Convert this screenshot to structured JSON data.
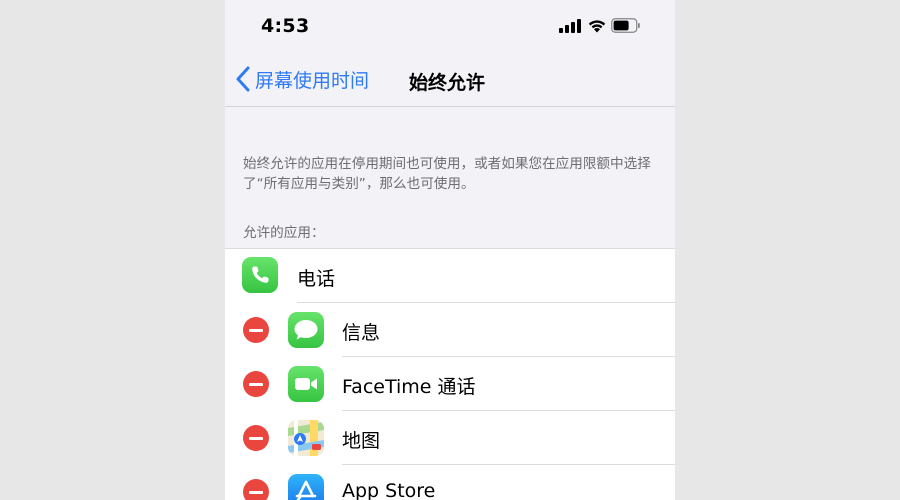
{
  "status_bar": {
    "time": "4:53",
    "icons": [
      "signal-icon",
      "wifi-icon",
      "battery-icon"
    ]
  },
  "nav": {
    "back_label": "屏幕使用时间",
    "title": "始终允许"
  },
  "description": "始终允许的应用在停用期间也可使用，或者如果您在应用限额中选择了“所有应用与类别”，那么也可使用。",
  "section_header": "允许的应用：",
  "apps": [
    {
      "label": "电话",
      "icon": "phone-icon",
      "removable": false
    },
    {
      "label": "信息",
      "icon": "messages-icon",
      "removable": true
    },
    {
      "label": "FaceTime 通话",
      "icon": "facetime-icon",
      "removable": true
    },
    {
      "label": "地图",
      "icon": "maps-icon",
      "removable": true
    },
    {
      "label": "App Store",
      "icon": "app-store-icon",
      "removable": true
    }
  ],
  "colors": {
    "accent": "#2f7bf5",
    "remove": "#e9463f",
    "green_icon": "#4cd964",
    "app_store_blue": "#1e8ff5",
    "background": "#f2f2f7"
  }
}
